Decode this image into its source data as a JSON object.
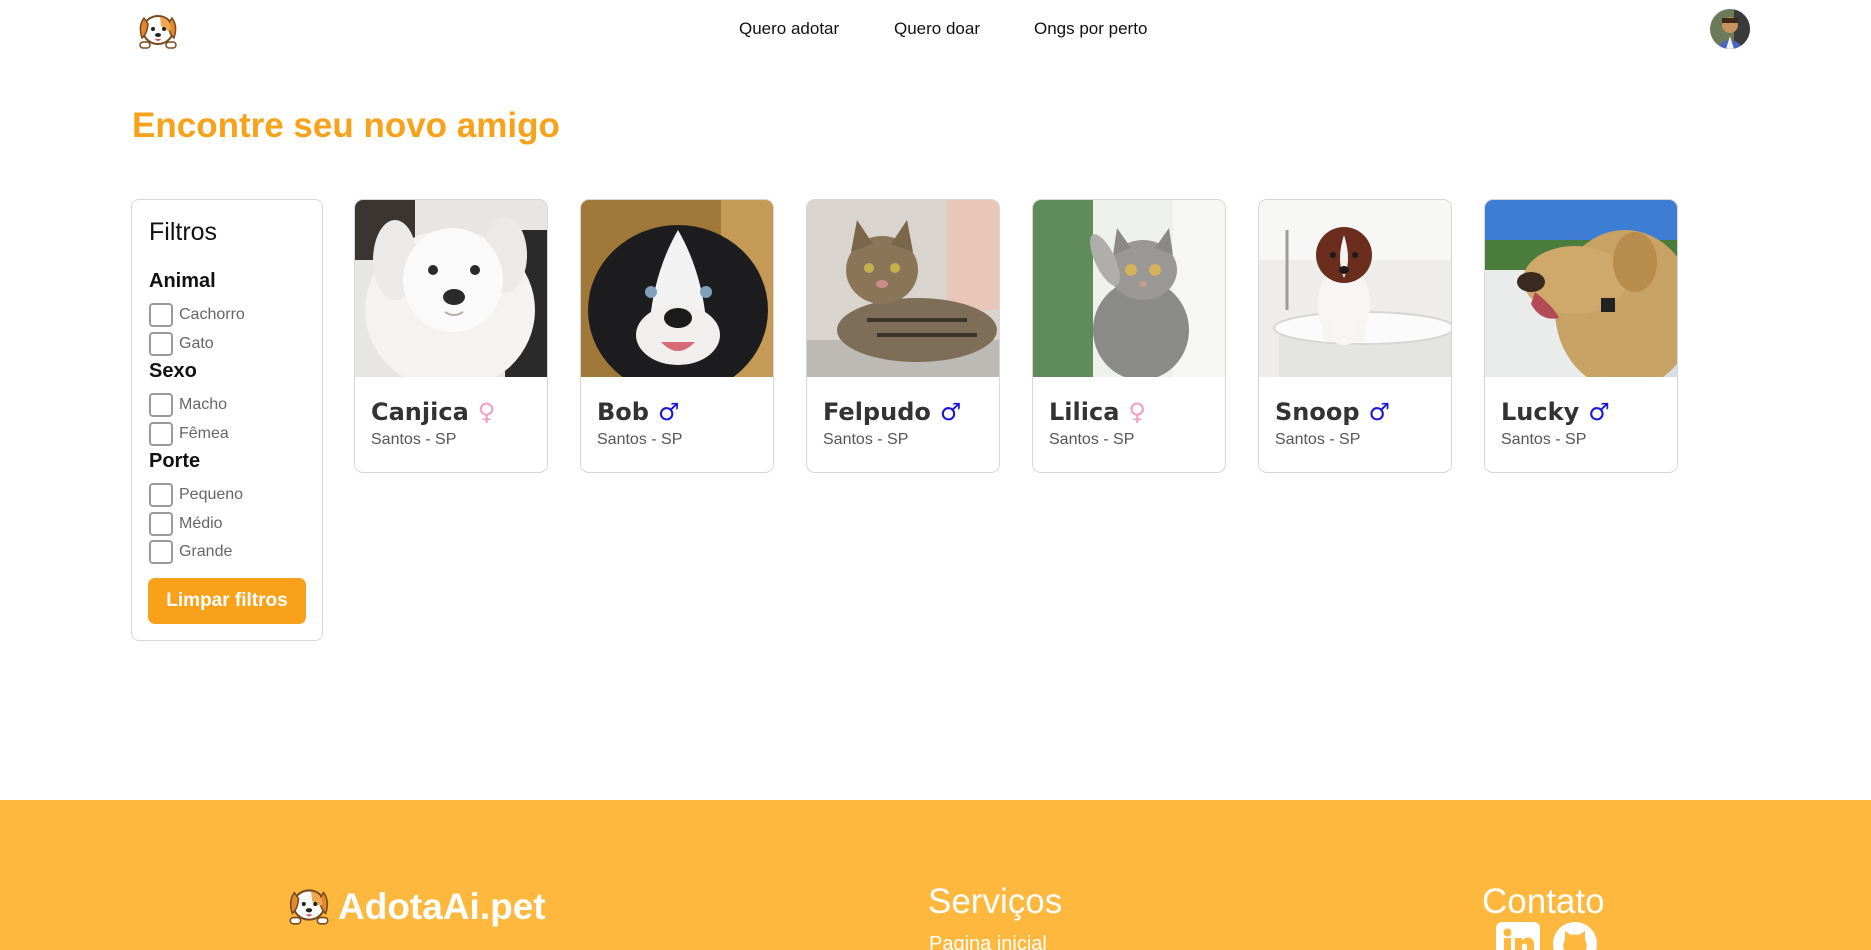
{
  "header": {
    "nav": [
      "Quero adotar",
      "Quero doar",
      "Ongs por perto"
    ]
  },
  "page": {
    "title": "Encontre seu novo amigo"
  },
  "filters": {
    "title": "Filtros",
    "groups": [
      {
        "title": "Animal",
        "options": [
          "Cachorro",
          "Gato"
        ]
      },
      {
        "title": "Sexo",
        "options": [
          "Macho",
          "Fêmea"
        ]
      },
      {
        "title": "Porte",
        "options": [
          "Pequeno",
          "Médio",
          "Grande"
        ]
      }
    ],
    "clear_label": "Limpar filtros"
  },
  "pets": [
    {
      "name": "Canjica",
      "sex_symbol": "♀",
      "sex": "female",
      "location": "Santos - SP"
    },
    {
      "name": "Bob",
      "sex_symbol": "♂",
      "sex": "male",
      "location": "Santos - SP"
    },
    {
      "name": "Felpudo",
      "sex_symbol": "♂",
      "sex": "male",
      "location": "Santos - SP"
    },
    {
      "name": "Lilica",
      "sex_symbol": "♀",
      "sex": "female",
      "location": "Santos - SP"
    },
    {
      "name": "Snoop",
      "sex_symbol": "♂",
      "sex": "male",
      "location": "Santos - SP"
    },
    {
      "name": "Lucky",
      "sex_symbol": "♂",
      "sex": "male",
      "location": "Santos - SP"
    }
  ],
  "footer": {
    "brand": "AdotaAi.pet",
    "services_title": "Serviços",
    "services_links": [
      "Pagina inicial"
    ],
    "contact_title": "Contato"
  },
  "colors": {
    "accent": "#f9a11b",
    "title": "#f7a21b",
    "footer_bg": "#fdb83d",
    "female": "#f4a0bd",
    "male": "#1a16d9"
  },
  "icons": {
    "logo": "dog-logo-icon",
    "avatar": "user-avatar",
    "social": [
      "linkedin-icon",
      "github-icon"
    ]
  }
}
